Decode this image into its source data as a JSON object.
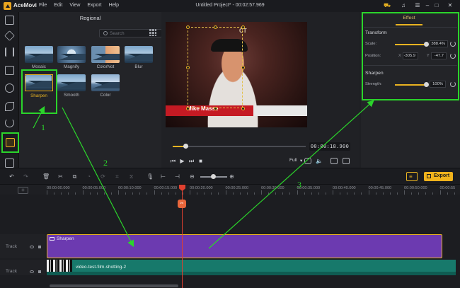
{
  "app": {
    "name": "AceMovi",
    "window_title": "Untitled Project* - 00:02:57.969",
    "menu": [
      "File",
      "Edit",
      "View",
      "Export",
      "Help"
    ]
  },
  "media_panel": {
    "title": "Regional",
    "search_placeholder": "Search",
    "effects": [
      {
        "label": "Mosaic",
        "style": "landscape"
      },
      {
        "label": "Magnify",
        "style": "magnify"
      },
      {
        "label": "ColorNot",
        "style": "colornot"
      },
      {
        "label": "Blur",
        "style": "landscape"
      },
      {
        "label": "Sharpen",
        "style": "landscape",
        "selected": true
      },
      {
        "label": "Smooth",
        "style": "landscape"
      },
      {
        "label": "Color",
        "style": "color"
      }
    ]
  },
  "preview": {
    "lower_third_name": "Mike Masse",
    "watermark": "CT",
    "timecode": "00:00:18.900",
    "quality": "Full"
  },
  "effect_panel": {
    "tab": "Effect",
    "transform_header": "Transform",
    "scale_label": "Scale:",
    "scale_value": "388.4%",
    "position_label": "Position:",
    "x_axis": "X",
    "x_value": "-305.9",
    "y_axis": "Y",
    "y_value": "-47.7",
    "sharpen_header": "Sharpen",
    "strength_label": "Strength:",
    "strength_value": "100%"
  },
  "toolbar": {
    "export_label": "Export"
  },
  "timeline": {
    "ruler": [
      "00:00:00.000",
      "00:00:05.000",
      "00:00:10.000",
      "00:00:15.000",
      "00:00:20.000",
      "00:00:25.000",
      "00:00:30.000",
      "00:00:35.000",
      "00:00:40.000",
      "00:00:45.000",
      "00:00:50.000",
      "00:00:55"
    ],
    "tracks": [
      {
        "name": "Track"
      },
      {
        "name": "Track"
      }
    ],
    "effect_clip_label": "Sharpen",
    "video_clip_label": "video-test-film-shotting-2"
  },
  "annotations": {
    "step1": "1",
    "step2": "2",
    "step3": "3",
    "color": "#2bd42b"
  }
}
